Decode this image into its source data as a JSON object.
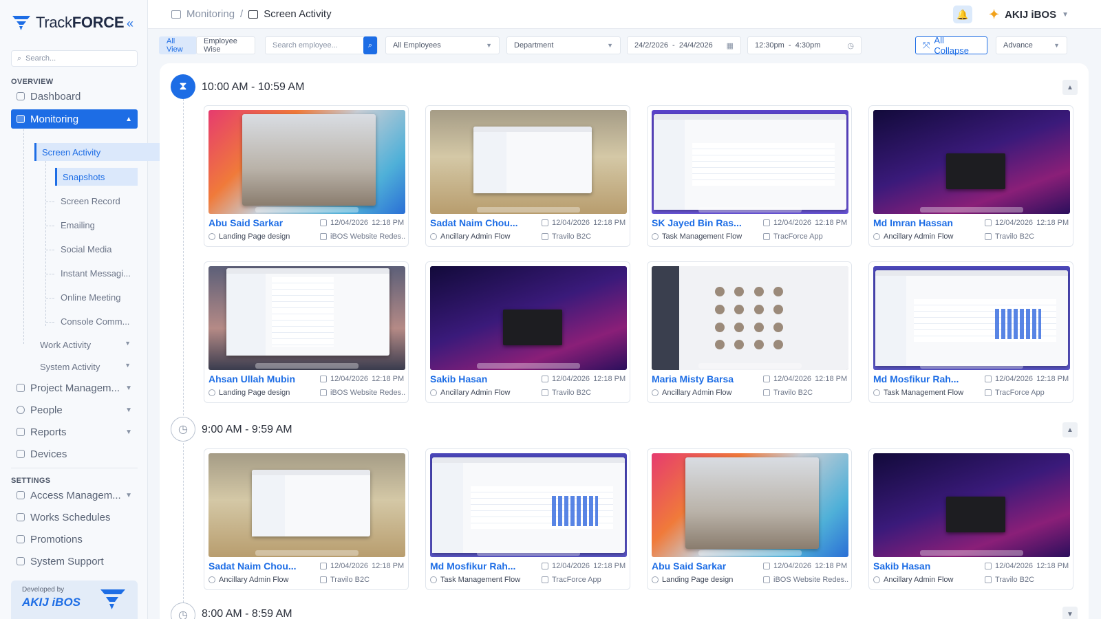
{
  "app": {
    "logo_prefix": "Track",
    "logo_bold": "FORCE",
    "collapse_glyph": "«"
  },
  "sidebar": {
    "search_placeholder": "Search...",
    "overview_title": "OVERVIEW",
    "dashboard": "Dashboard",
    "monitoring": "Monitoring",
    "screen_activity": "Screen Activity",
    "sub_items": [
      "Snapshots",
      "Screen Record",
      "Emailing",
      "Social Media",
      "Instant Messagi...",
      "Online Meeting",
      "Console Comm..."
    ],
    "work_activity": "Work Activity",
    "system_activity": "System Activity",
    "project_management": "Project Managem...",
    "people": "People",
    "reports": "Reports",
    "devices": "Devices",
    "settings_title": "SETTINGS",
    "access_management": "Access Managem...",
    "works_schedules": "Works Schedules",
    "promotions": "Promotions",
    "system_support": "System Support",
    "developed_by": "Developed by",
    "developer": "AKIJ iBOS"
  },
  "header": {
    "crumb_parent": "Monitoring",
    "crumb_sep": "/",
    "crumb_current": "Screen Activity",
    "org_name": "AKIJ iBOS"
  },
  "toolbar": {
    "view_all": "All View",
    "view_employee": "Employee Wise",
    "search_placeholder": "Search employee...",
    "employees_select": "All Employees",
    "department_select": "Department",
    "date_range": "24/2/2026  -  24/4/2026",
    "time_range": "12:30pm  -  4:30pm",
    "collapse_all": "All Collapse",
    "advance_select": "Advance"
  },
  "slots": [
    {
      "title": "10:00 AM - 10:59 AM",
      "cards": [
        {
          "name": "Abu Said Sarkar",
          "date": "12/04/2026",
          "time": "12:18 PM",
          "task": "Landing Page design",
          "project": "iBOS Website Redes...",
          "shot": "colorful"
        },
        {
          "name": "Sadat Naim Chou...",
          "date": "12/04/2026",
          "time": "12:18 PM",
          "task": "Ancillary Admin  Flow",
          "project": "Travilo B2C",
          "shot": "desert"
        },
        {
          "name": "SK Jayed Bin Ras...",
          "date": "12/04/2026",
          "time": "12:18 PM",
          "task": "Task Management Flow",
          "project": "TracForce App",
          "shot": "app"
        },
        {
          "name": "Md Imran Hassan",
          "date": "12/04/2026",
          "time": "12:18 PM",
          "task": "Ancillary Admin  Flow",
          "project": "Travilo B2C",
          "shot": "purple"
        },
        {
          "name": "Ahsan Ullah Mubin",
          "date": "12/04/2026",
          "time": "12:18 PM",
          "task": "Landing Page design",
          "project": "iBOS Website Redes...",
          "shot": "mail"
        },
        {
          "name": "Sakib Hasan",
          "date": "12/04/2026",
          "time": "12:18 PM",
          "task": "Ancillary Admin  Flow",
          "project": "Travilo B2C",
          "shot": "purple"
        },
        {
          "name": "Maria Misty Barsa",
          "date": "12/04/2026",
          "time": "12:18 PM",
          "task": "Ancillary Admin  Flow",
          "project": "Travilo B2C",
          "shot": "meeting"
        },
        {
          "name": "Md Mosfikur Rah...",
          "date": "12/04/2026",
          "time": "12:18 PM",
          "task": "Task Management Flow",
          "project": "TracForce App",
          "shot": "table"
        }
      ]
    },
    {
      "title": "9:00 AM - 9:59 AM",
      "cards": [
        {
          "name": "Sadat Naim Chou...",
          "date": "12/04/2026",
          "time": "12:18 PM",
          "task": "Ancillary Admin  Flow",
          "project": "Travilo B2C",
          "shot": "desert"
        },
        {
          "name": "Md Mosfikur Rah...",
          "date": "12/04/2026",
          "time": "12:18 PM",
          "task": "Task Management Flow",
          "project": "TracForce App",
          "shot": "table"
        },
        {
          "name": "Abu Said Sarkar",
          "date": "12/04/2026",
          "time": "12:18 PM",
          "task": "Landing Page design",
          "project": "iBOS Website Redes...",
          "shot": "colorful"
        },
        {
          "name": "Sakib Hasan",
          "date": "12/04/2026",
          "time": "12:18 PM",
          "task": "Ancillary Admin  Flow",
          "project": "Travilo B2C",
          "shot": "purple"
        }
      ]
    },
    {
      "title": "8:00 AM - 8:59 AM",
      "cards": []
    }
  ],
  "colors": {
    "accent": "#1d6de5",
    "accent_light": "#dbe8fb"
  }
}
